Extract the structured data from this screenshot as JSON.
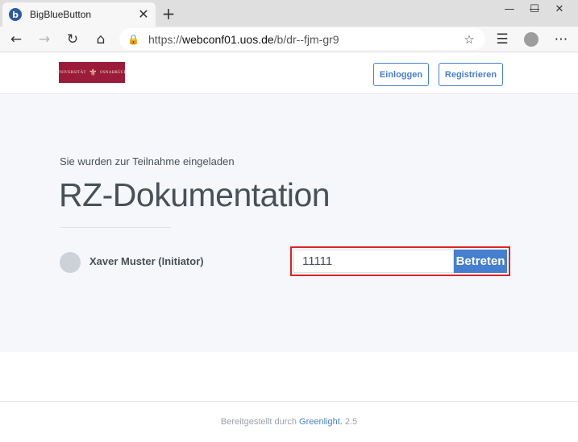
{
  "browser": {
    "tab_title": "BigBlueButton",
    "favicon_letter": "b",
    "url_prefix": "https://",
    "url_host": "webconf01.uos.de",
    "url_path": "/b/dr--fjm-gr9",
    "icons": {
      "back": "←",
      "forward": "→",
      "reload": "↻",
      "home": "⌂",
      "lock": "🔒",
      "favorite": "☆",
      "collections": "☰",
      "more": "⋯",
      "new_tab": "+",
      "close_tab": "✕",
      "minimize": "—",
      "maximize": "☐",
      "close_window": "✕"
    }
  },
  "header": {
    "logo_text_left": "UNIVERSITÄT",
    "logo_text_right": "OSNABRÜCK",
    "login_label": "Einloggen",
    "register_label": "Registrieren"
  },
  "room": {
    "invited_text": "Sie wurden zur Teilnahme eingeladen",
    "title": "RZ-Dokumentation",
    "owner_name": "Xaver Muster (Initiator)",
    "join_input_value": "11111",
    "join_button_label": "Betreten"
  },
  "footer": {
    "provided_by": "Bereitgestellt durch",
    "link_text": "Greenlight.",
    "version": "2.5"
  },
  "colors": {
    "accent": "#467fcf",
    "highlight": "#e02323",
    "logo_bg": "#9a1b3a"
  }
}
